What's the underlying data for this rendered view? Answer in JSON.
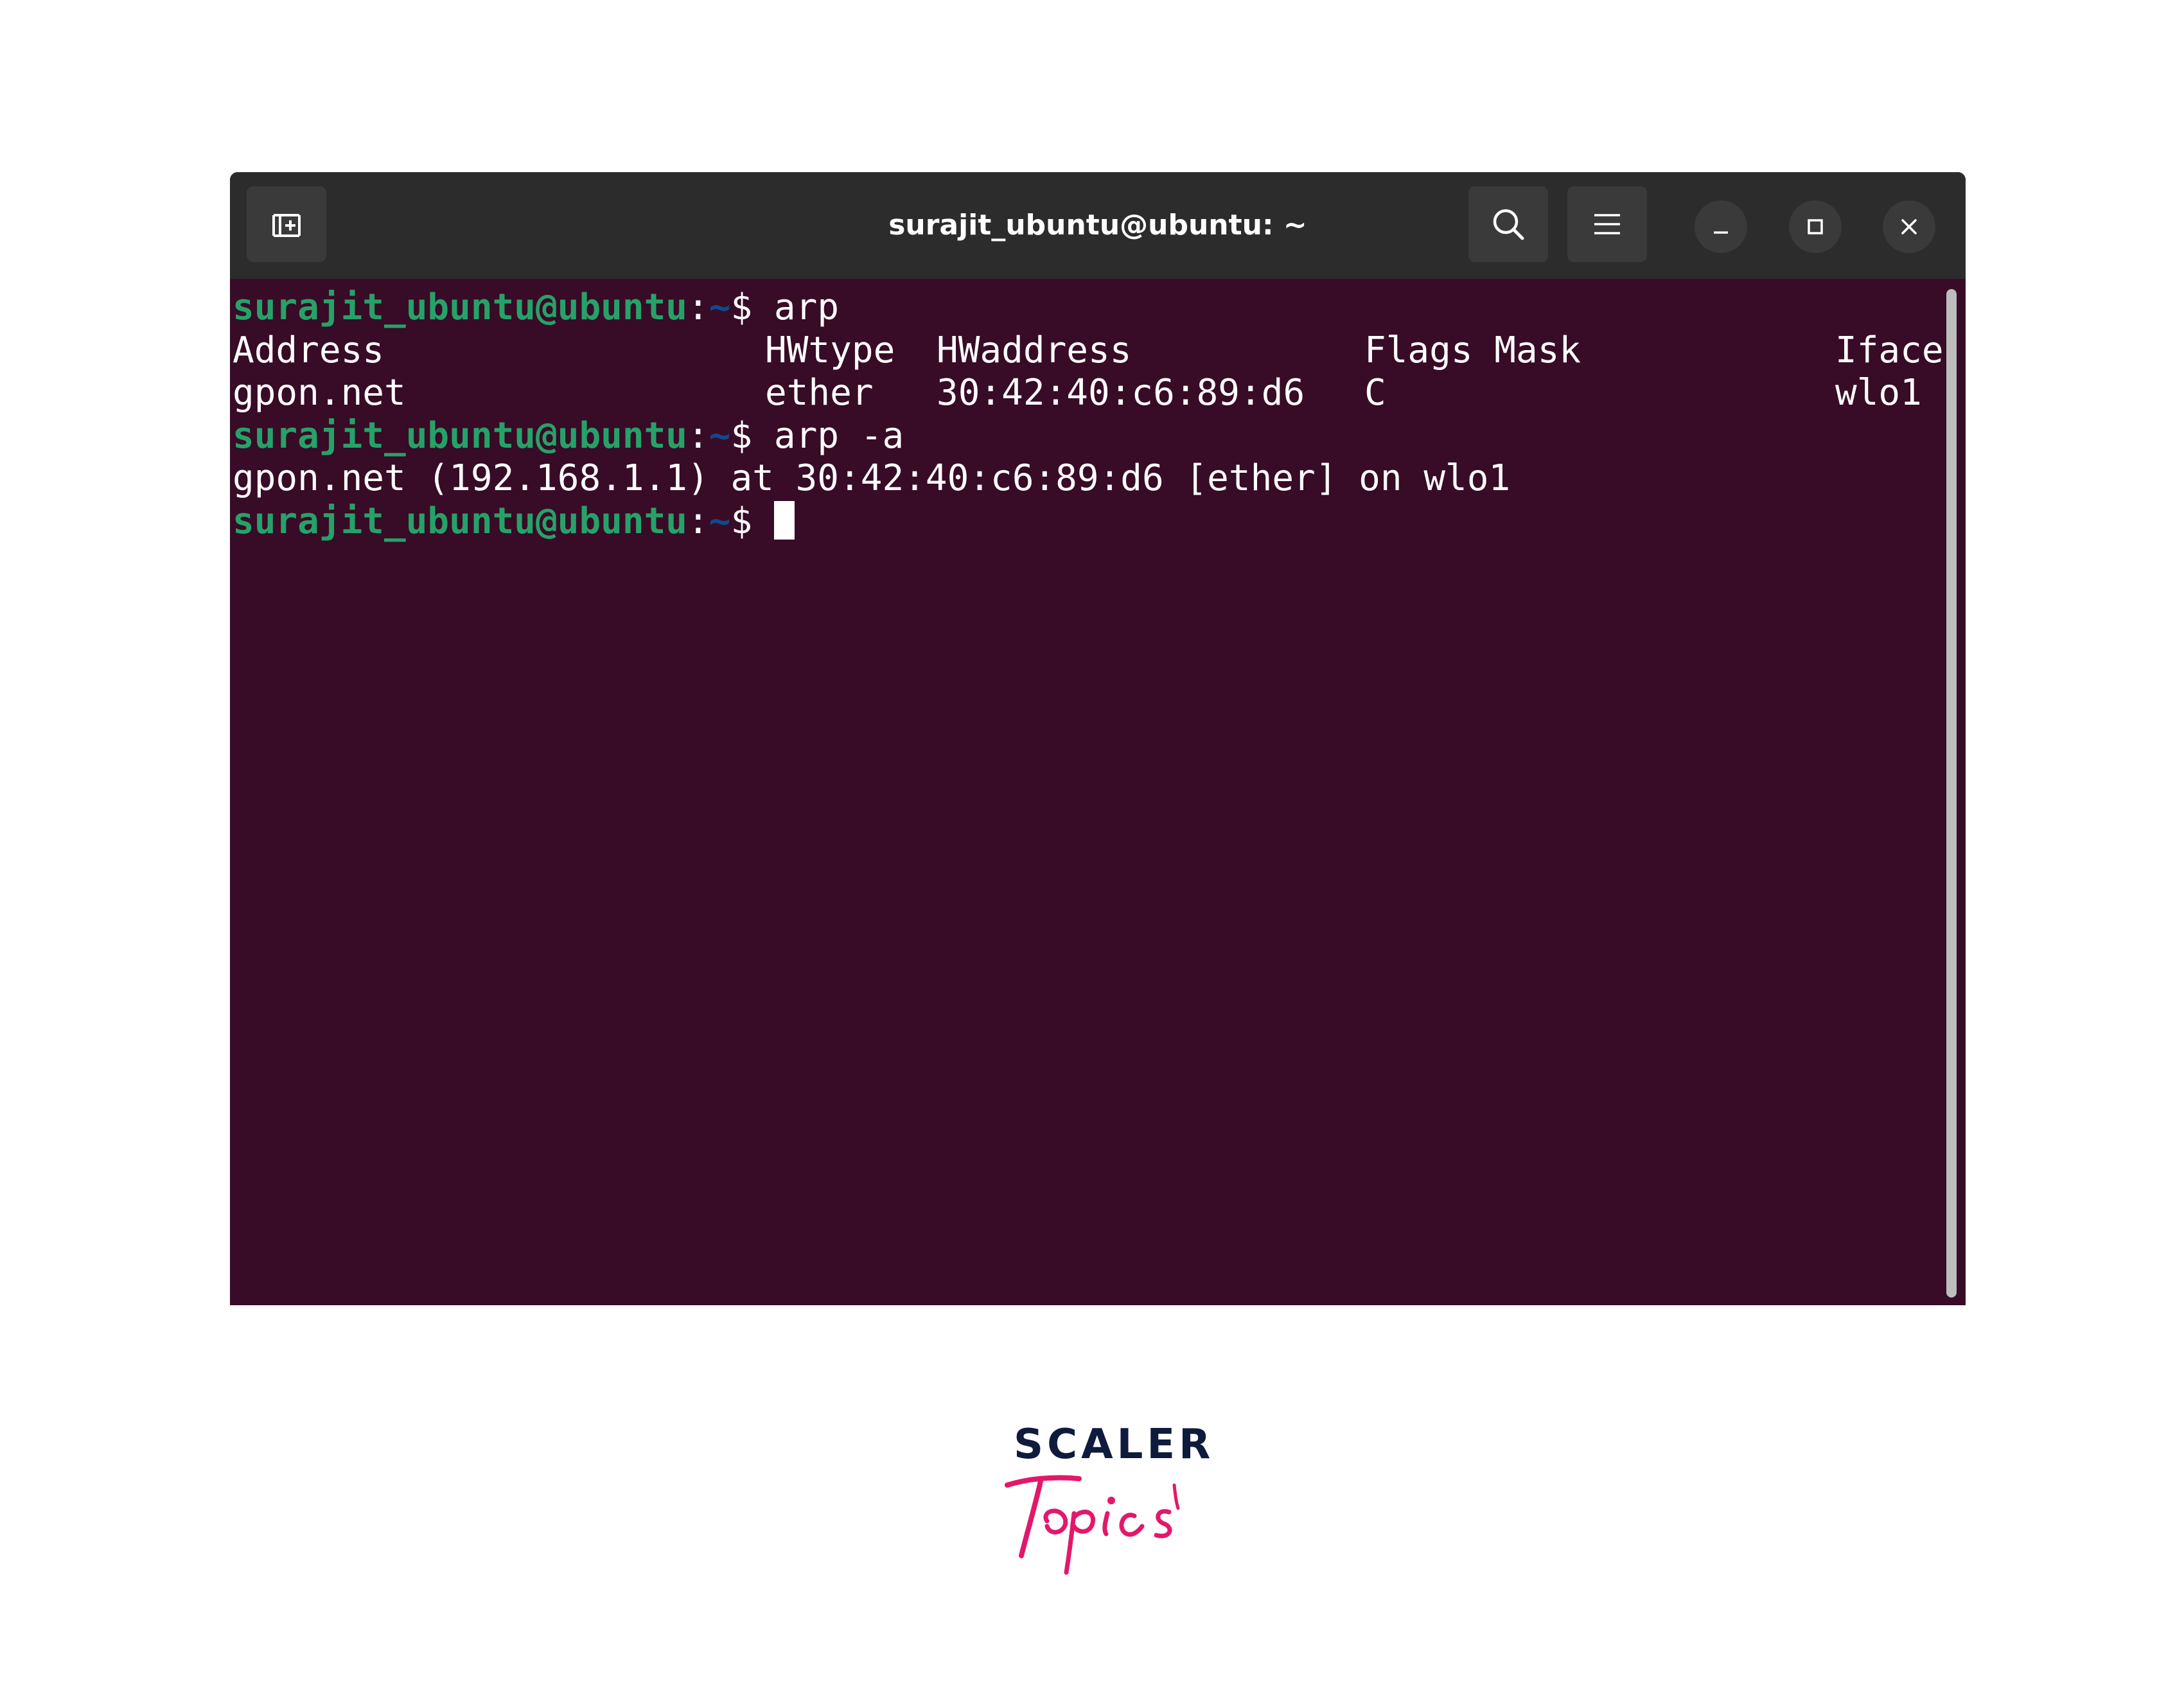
{
  "window": {
    "title": "surajit_ubuntu@ubuntu: ~",
    "buttons": {
      "new_tab": "new-tab-icon",
      "search": "search-icon",
      "menu": "hamburger-menu-icon",
      "minimize": "minimize-icon",
      "maximize": "maximize-icon",
      "close": "close-icon"
    }
  },
  "terminal": {
    "prompt": {
      "user": "surajit_ubuntu@ubuntu",
      "colon": ":",
      "path": "~",
      "symbol": "$"
    },
    "command1": "arp",
    "table_headers": {
      "address": "Address",
      "hwtype": "HWtype",
      "hwaddress": "HWaddress",
      "flags_mask": "Flags Mask",
      "iface": "Iface"
    },
    "table_row": {
      "address": "gpon.net",
      "hwtype": "ether",
      "hwaddress": "30:42:40:c6:89:d6",
      "flags": "C",
      "iface": "wlo1"
    },
    "command2": "arp -a",
    "output2": "gpon.net (192.168.1.1) at 30:42:40:c6:89:d6 [ether] on wlo1"
  },
  "logo": {
    "top": "SCALER",
    "script": "Topics"
  },
  "colors": {
    "terminal_bg": "#380b26",
    "titlebar_bg": "#2c2c2c",
    "prompt_user": "#26a269",
    "prompt_path": "#12488b",
    "logo_navy": "#0f1b3d",
    "logo_pink": "#e3186b"
  }
}
